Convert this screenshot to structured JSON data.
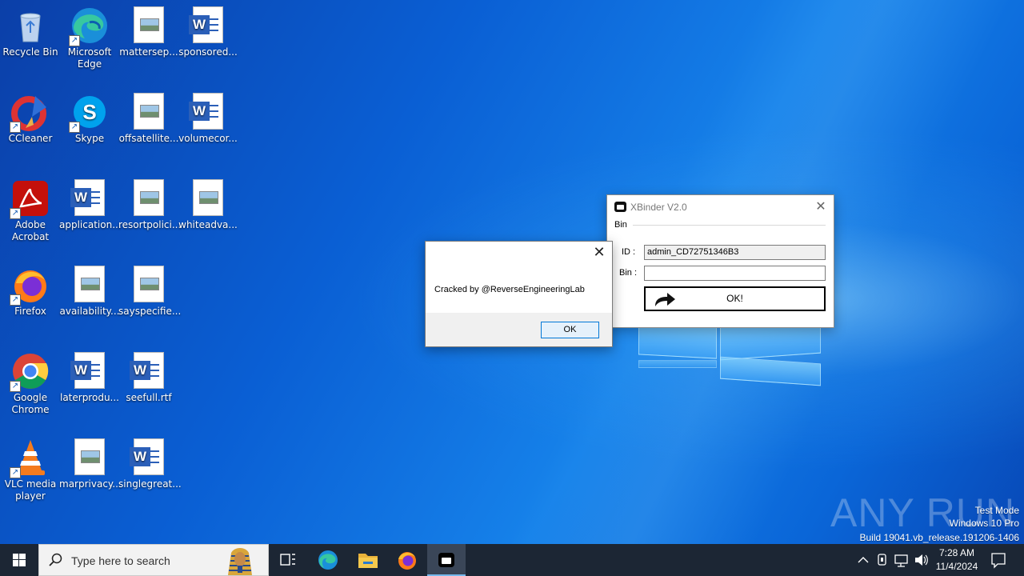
{
  "desktop": {
    "icons": [
      {
        "label": "Recycle Bin",
        "type": "recycle-bin"
      },
      {
        "label": "Microsoft Edge",
        "type": "edge"
      },
      {
        "label": "mattersep...",
        "type": "image-file"
      },
      {
        "label": "sponsored...",
        "type": "word-file"
      },
      {
        "label": "CCleaner",
        "type": "ccleaner"
      },
      {
        "label": "Skype",
        "type": "skype"
      },
      {
        "label": "offsatellite...",
        "type": "image-file"
      },
      {
        "label": "volumecor...",
        "type": "word-file"
      },
      {
        "label": "Adobe Acrobat",
        "type": "acrobat"
      },
      {
        "label": "application...",
        "type": "word-file"
      },
      {
        "label": "resortpolici...",
        "type": "image-file"
      },
      {
        "label": "whiteadva...",
        "type": "image-file"
      },
      {
        "label": "Firefox",
        "type": "firefox"
      },
      {
        "label": "availability...",
        "type": "image-file"
      },
      {
        "label": "sayspecifie...",
        "type": "image-file"
      },
      {
        "label": "Google Chrome",
        "type": "chrome"
      },
      {
        "label": "laterprodu...",
        "type": "word-file"
      },
      {
        "label": "seefull.rtf",
        "type": "word-file"
      },
      {
        "label": "VLC media player",
        "type": "vlc"
      },
      {
        "label": "marprivacy...",
        "type": "image-file"
      },
      {
        "label": "singlegreat...",
        "type": "word-file"
      }
    ]
  },
  "message_box": {
    "text": "Cracked by @ReverseEngineeringLab",
    "ok_label": "OK",
    "close_glyph": "✕"
  },
  "xbinder": {
    "title": "XBinder V2.0",
    "close_glyph": "✕",
    "group_label": "Bin",
    "id_label": "ID :",
    "id_value": "admin_CD72751346B3",
    "bin_label": "Bin :",
    "bin_value": "",
    "ok_label": "OK!"
  },
  "watermark": {
    "brand": "ANY RUN",
    "mode": "Test Mode",
    "os": "Windows 10 Pro",
    "build": "Build 19041.vb_release.191206-1406"
  },
  "taskbar": {
    "search_placeholder": "Type here to search",
    "time": "7:28 AM",
    "date": "11/4/2024",
    "colors": {
      "bar": "#1c2634",
      "accent": "#76b9ed"
    }
  }
}
